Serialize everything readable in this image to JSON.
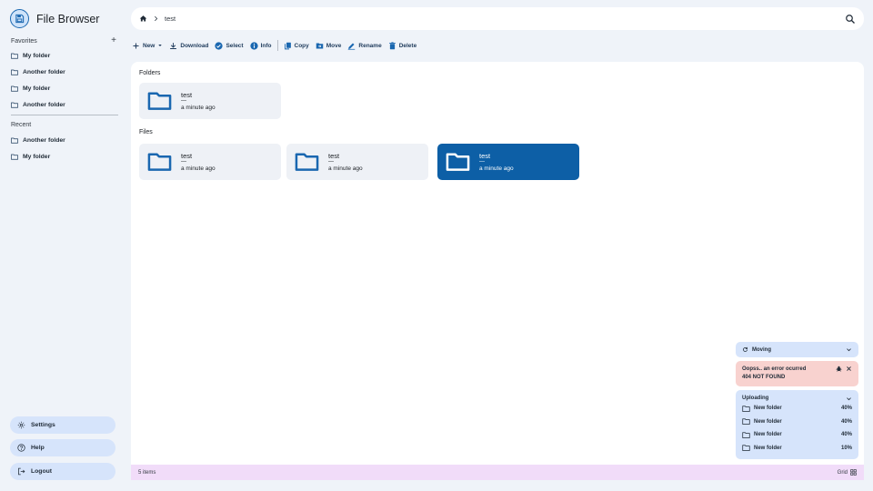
{
  "app": {
    "title": "File Browser",
    "accent": "#0d5fa6"
  },
  "sidebar": {
    "favorites_label": "Favorites",
    "favorites": [
      {
        "label": "My folder",
        "icon": "folder-outline-icon"
      },
      {
        "label": "Another folder",
        "icon": "folder-outline-icon"
      },
      {
        "label": "My folder",
        "icon": "folder-outline-icon"
      },
      {
        "label": "Another folder",
        "icon": "folder-outline-icon"
      }
    ],
    "recent_label": "Recent",
    "recent": [
      {
        "label": "Another folder",
        "icon": "folder-outline-icon"
      },
      {
        "label": "My folder",
        "icon": "folder-outline-icon"
      }
    ],
    "settings_label": "Settings",
    "help_label": "Help",
    "logout_label": "Logout"
  },
  "header": {
    "breadcrumb_current": "test"
  },
  "toolbar": {
    "new_label": "New",
    "download_label": "Download",
    "select_label": "Select",
    "info_label": "Info",
    "copy_label": "Copy",
    "move_label": "Move",
    "rename_label": "Rename",
    "delete_label": "Delete"
  },
  "main": {
    "folders_label": "Folders",
    "files_label": "Files",
    "folders": [
      {
        "name": "test",
        "size": "—",
        "modified": "a minute ago"
      }
    ],
    "files": [
      {
        "name": "test",
        "size": "—",
        "modified": "a minute ago",
        "selected": false
      },
      {
        "name": "test",
        "size": "—",
        "modified": "a minute ago",
        "selected": false
      },
      {
        "name": "test",
        "size": "—",
        "modified": "a minute ago",
        "selected": true
      }
    ]
  },
  "statusbar": {
    "count": "5 items",
    "view_label": "Grid"
  },
  "notifications": {
    "moving": {
      "label": "Moving"
    },
    "error": {
      "title": "Oopss.. an error ocurred",
      "message": "404 NOT FOUND",
      "color": "#f8d2cf"
    },
    "uploading": {
      "label": "Uploading",
      "items": [
        {
          "name": "New folder",
          "progress": "40%"
        },
        {
          "name": "New folder",
          "progress": "40%"
        },
        {
          "name": "New folder",
          "progress": "40%"
        },
        {
          "name": "New folder",
          "progress": "10%"
        }
      ]
    }
  }
}
